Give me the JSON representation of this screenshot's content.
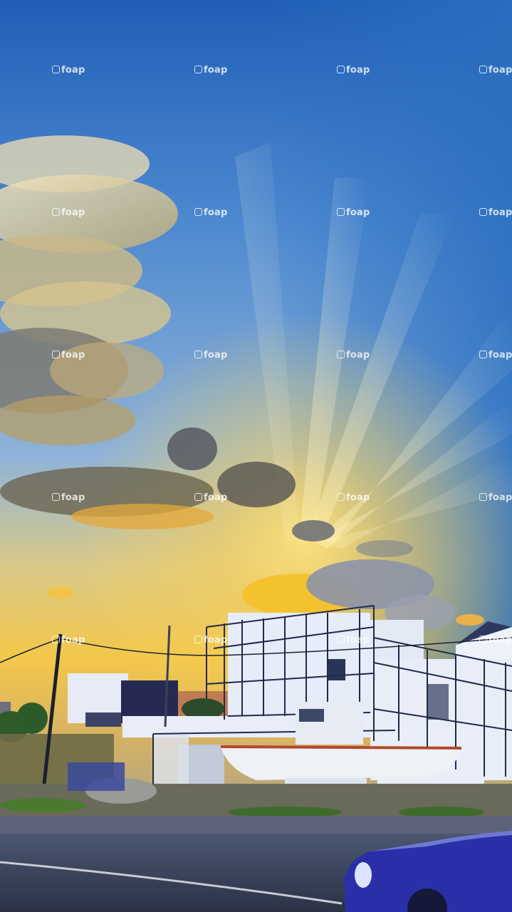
{
  "photo": {
    "watermark_text": "foap",
    "watermark_icon": "camera-logo-icon",
    "colors": {
      "sky_top": "#1f5fb8",
      "sky_mid": "#6c9fd6",
      "glow": "#f5c63a",
      "horizon": "#f0b43a",
      "building": "#e9eef8",
      "car": "#2a2fa8"
    }
  }
}
